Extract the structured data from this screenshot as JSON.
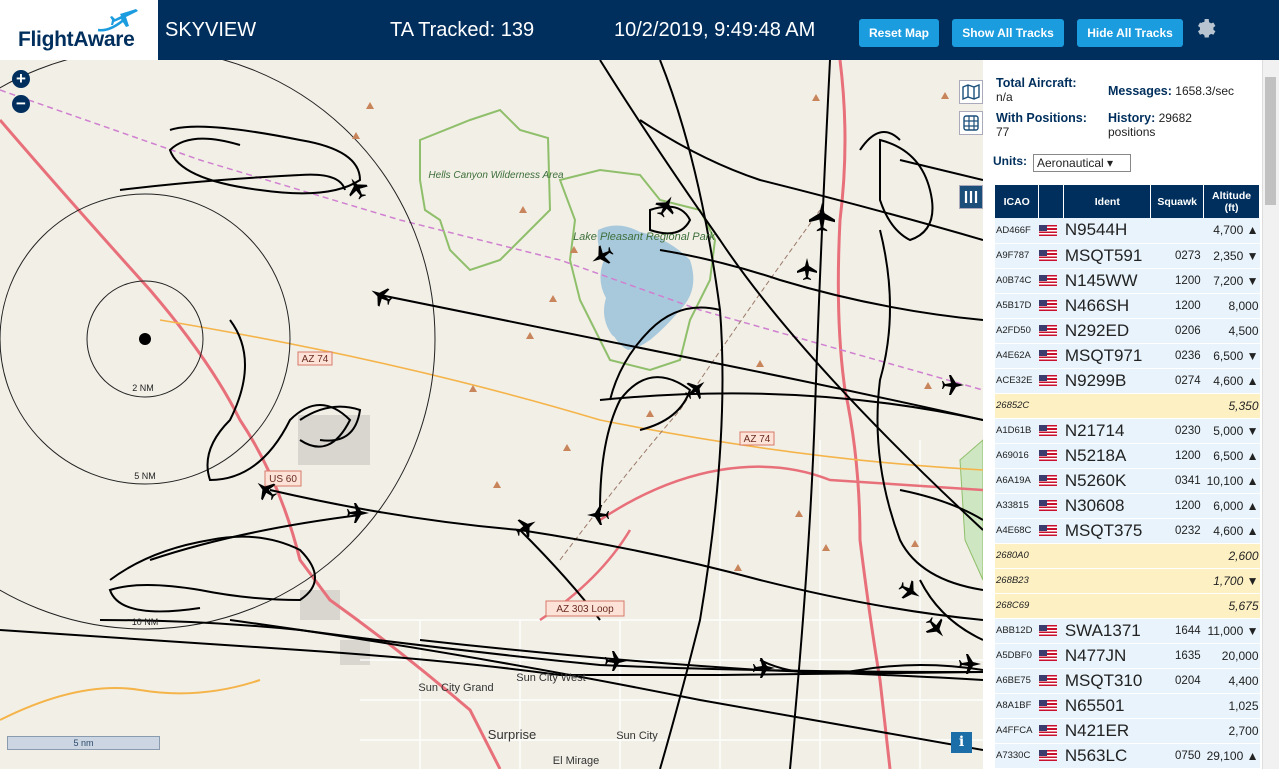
{
  "header": {
    "logo_text": "FlightAware",
    "site_name": "SKYVIEW",
    "ta_tracked": "TA Tracked: 139",
    "datetime": "10/2/2019, 9:49:48 AM",
    "buttons": {
      "reset": "Reset Map",
      "show_all": "Show All Tracks",
      "hide_all": "Hide All Tracks"
    },
    "settings_icon": "gear-icon"
  },
  "map": {
    "zoom_in": "+",
    "zoom_out": "−",
    "scale_label": "5 nm",
    "info": "i",
    "range_labels": [
      "2 NM",
      "5 NM",
      "10 NM"
    ],
    "place_labels": [
      "Hells Canyon Wilderness Area",
      "Lake Pleasant Regional Park",
      "Sun City Grand",
      "Sun City West",
      "Surprise",
      "Sun City",
      "El Mirage"
    ],
    "road_shields": [
      "AZ 74",
      "AZ 74",
      "US 60",
      "AZ 303 Loop"
    ],
    "colors": {
      "land": "#f2efe6",
      "water": "#a8c8dc",
      "park_border": "#8fbf6b",
      "track": "#000000",
      "highway": "#e8707a",
      "major_road": "#f5b44a"
    }
  },
  "sidebar": {
    "total_aircraft_label": "Total Aircraft:",
    "total_aircraft_value": "n/a",
    "with_positions_label": "With Positions:",
    "with_positions_value": "77",
    "messages_label": "Messages:",
    "messages_value": "1658.3/sec",
    "history_label": "History:",
    "history_value": "29682",
    "history_unit": "positions",
    "units_label": "Units:",
    "units_value": "Aeronautical ▾",
    "table_headers": [
      "ICAO",
      "",
      "Ident",
      "Squawk",
      "Altitude (ft)"
    ],
    "rows": [
      {
        "icao": "AD466F",
        "flag": true,
        "ident": "N9544H",
        "squawk": "",
        "alt": "4,700 ▲",
        "known": true
      },
      {
        "icao": "A9F787",
        "flag": true,
        "ident": "MSQT591",
        "squawk": "0273",
        "alt": "2,350 ▼",
        "known": true
      },
      {
        "icao": "A0B74C",
        "flag": true,
        "ident": "N145WW",
        "squawk": "1200",
        "alt": "7,200 ▼",
        "known": true
      },
      {
        "icao": "A5B17D",
        "flag": true,
        "ident": "N466SH",
        "squawk": "1200",
        "alt": "8,000",
        "known": true
      },
      {
        "icao": "A2FD50",
        "flag": true,
        "ident": "N292ED",
        "squawk": "0206",
        "alt": "4,500",
        "known": true
      },
      {
        "icao": "A4E62A",
        "flag": true,
        "ident": "MSQT971",
        "squawk": "0236",
        "alt": "6,500 ▼",
        "known": true
      },
      {
        "icao": "ACE32E",
        "flag": true,
        "ident": "N9299B",
        "squawk": "0274",
        "alt": "4,600 ▲",
        "known": true
      },
      {
        "icao": "26852C",
        "flag": false,
        "ident": "",
        "squawk": "",
        "alt": "5,350",
        "known": false
      },
      {
        "icao": "A1D61B",
        "flag": true,
        "ident": "N21714",
        "squawk": "0230",
        "alt": "5,000 ▼",
        "known": true
      },
      {
        "icao": "A69016",
        "flag": true,
        "ident": "N5218A",
        "squawk": "1200",
        "alt": "6,500 ▲",
        "known": true
      },
      {
        "icao": "A6A19A",
        "flag": true,
        "ident": "N5260K",
        "squawk": "0341",
        "alt": "10,100 ▲",
        "known": true
      },
      {
        "icao": "A33815",
        "flag": true,
        "ident": "N30608",
        "squawk": "1200",
        "alt": "6,000 ▲",
        "known": true
      },
      {
        "icao": "A4E68C",
        "flag": true,
        "ident": "MSQT375",
        "squawk": "0232",
        "alt": "4,600 ▲",
        "known": true
      },
      {
        "icao": "2680A0",
        "flag": false,
        "ident": "",
        "squawk": "",
        "alt": "2,600",
        "known": false
      },
      {
        "icao": "268B23",
        "flag": false,
        "ident": "",
        "squawk": "",
        "alt": "1,700 ▼",
        "known": false
      },
      {
        "icao": "268C69",
        "flag": false,
        "ident": "",
        "squawk": "",
        "alt": "5,675",
        "known": false
      },
      {
        "icao": "ABB12D",
        "flag": true,
        "ident": "SWA1371",
        "squawk": "1644",
        "alt": "11,000 ▼",
        "known": true
      },
      {
        "icao": "A5DBF0",
        "flag": true,
        "ident": "N477JN",
        "squawk": "1635",
        "alt": "20,000",
        "known": true
      },
      {
        "icao": "A6BE75",
        "flag": true,
        "ident": "MSQT310",
        "squawk": "0204",
        "alt": "4,400",
        "known": true
      },
      {
        "icao": "A8A1BF",
        "flag": true,
        "ident": "N65501",
        "squawk": "",
        "alt": "1,025",
        "known": true
      },
      {
        "icao": "A4FFCA",
        "flag": true,
        "ident": "N421ER",
        "squawk": "",
        "alt": "2,700",
        "known": true
      },
      {
        "icao": "A7330C",
        "flag": true,
        "ident": "N563LC",
        "squawk": "0750",
        "alt": "29,100 ▲",
        "known": true
      }
    ]
  }
}
